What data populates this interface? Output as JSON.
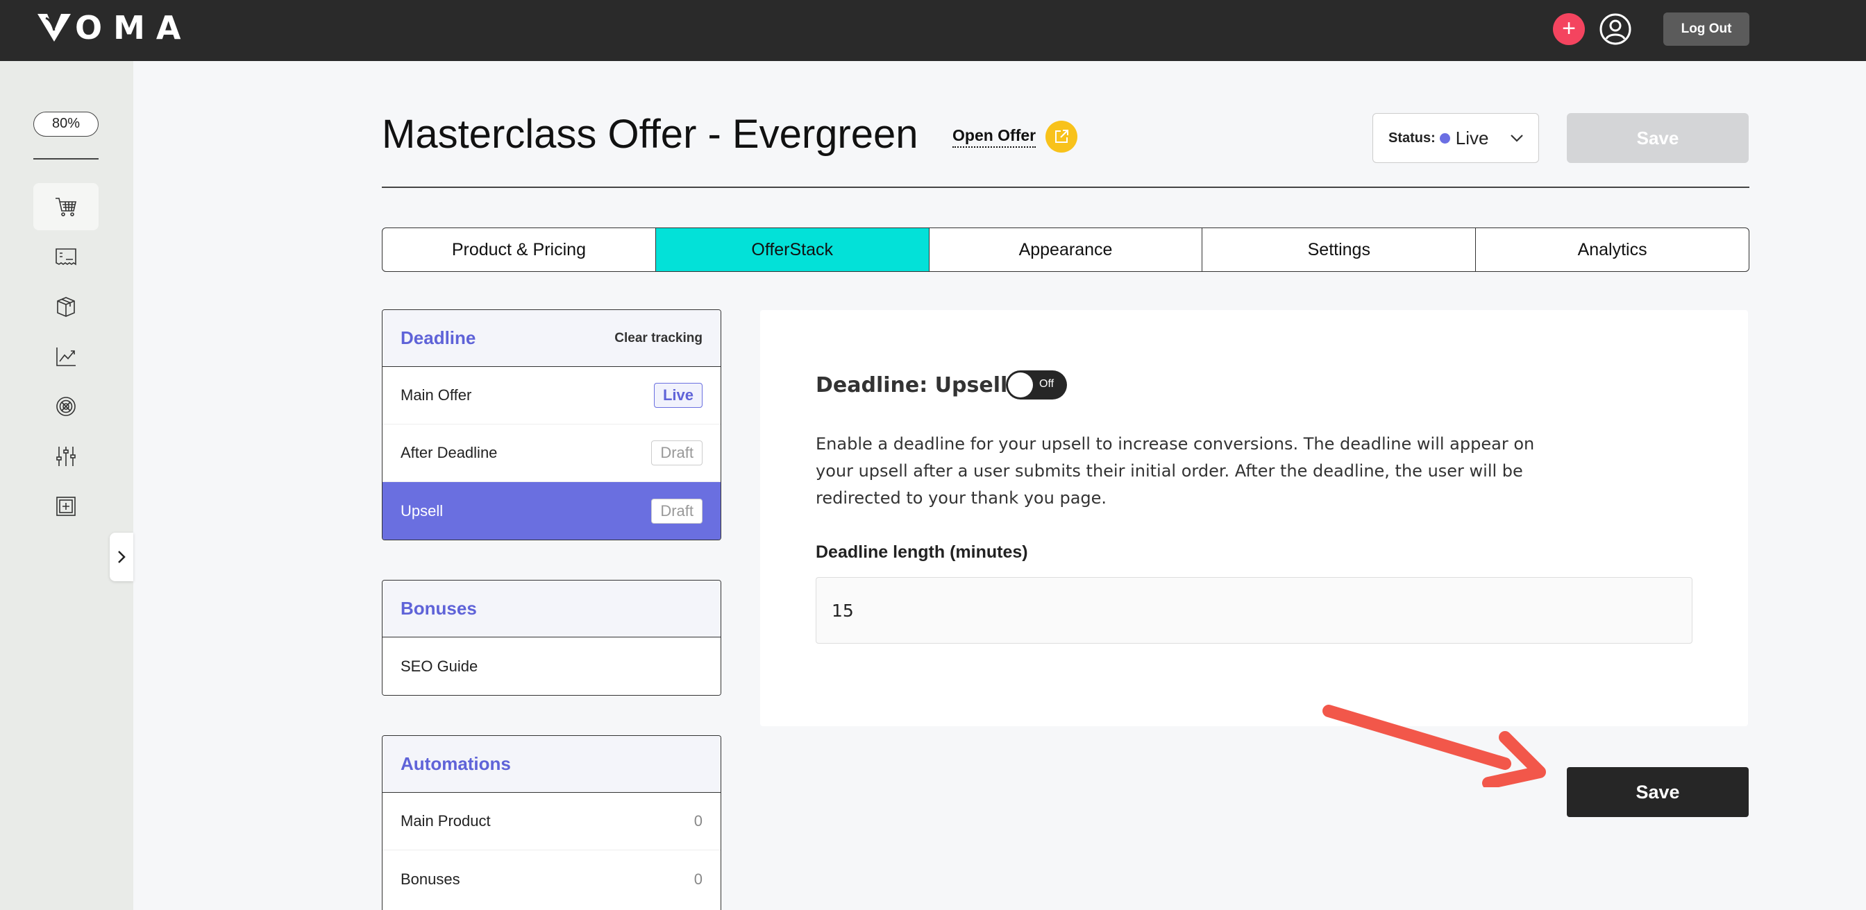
{
  "app": {
    "brand": "OMA"
  },
  "topbar": {
    "add_label": "+",
    "logout_label": "Log Out"
  },
  "sidebar": {
    "zoom": "80%",
    "icons": [
      "cart-icon",
      "invoice-icon",
      "box-icon",
      "chart-icon",
      "target-icon",
      "sliders-icon",
      "grid-plus-icon"
    ],
    "active_icon": "cart-icon"
  },
  "header": {
    "title": "Masterclass Offer - Evergreen",
    "open_offer": "Open Offer",
    "status_label": "Status:",
    "status_value": "Live",
    "status_color": "#6b6fe3",
    "save_label": "Save"
  },
  "tabs": [
    {
      "label": "Product & Pricing",
      "active": false
    },
    {
      "label": "OfferStack",
      "active": true
    },
    {
      "label": "Appearance",
      "active": false
    },
    {
      "label": "Settings",
      "active": false
    },
    {
      "label": "Analytics",
      "active": false
    }
  ],
  "deadline_panel": {
    "title": "Deadline",
    "action": "Clear tracking",
    "rows": [
      {
        "label": "Main Offer",
        "badge": "Live"
      },
      {
        "label": "After Deadline",
        "badge": "Draft"
      },
      {
        "label": "Upsell",
        "badge": "Draft"
      }
    ]
  },
  "bonuses_panel": {
    "title": "Bonuses",
    "rows": [
      {
        "label": "SEO Guide"
      }
    ]
  },
  "automations_panel": {
    "title": "Automations",
    "rows": [
      {
        "label": "Main Product",
        "count": "0"
      },
      {
        "label": "Bonuses",
        "count": "0"
      }
    ]
  },
  "content": {
    "heading": "Deadline: Upsell",
    "toggle_label": "Off",
    "description": "Enable a deadline for your upsell to increase conversions. The deadline will appear on your upsell after a user submits their initial order. After the deadline, the user will be redirected to your thank you page.",
    "field_label": "Deadline length (minutes)",
    "field_value": "15"
  },
  "footer": {
    "save_label": "Save"
  },
  "colors": {
    "accent": "#03e1d8",
    "primary": "#6a6fe0",
    "danger": "#f4445f",
    "arrow": "#f2574a"
  }
}
